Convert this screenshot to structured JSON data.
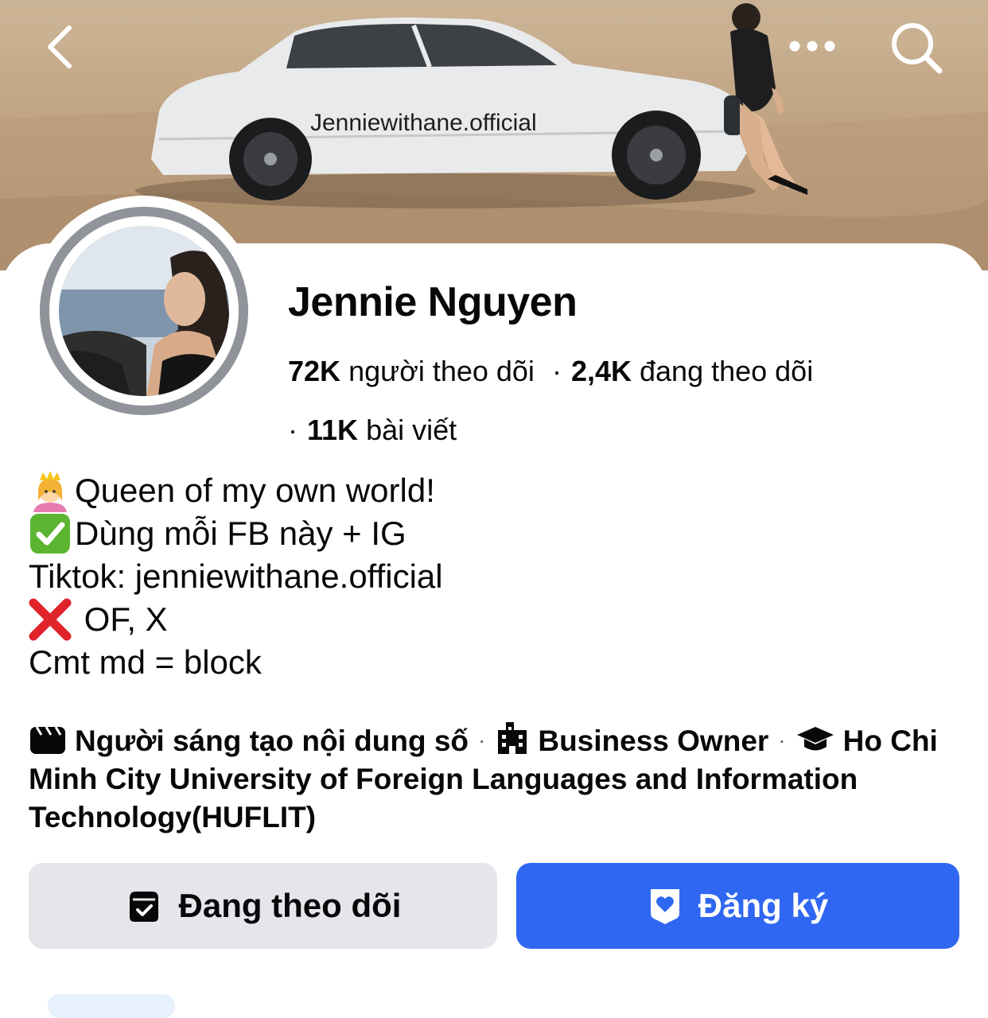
{
  "header": {
    "back_icon": "chevron-left-icon",
    "more_icon": "more-horizontal-icon",
    "search_icon": "search-icon"
  },
  "cover": {
    "car_text": "Jenniewithane.official"
  },
  "profile": {
    "name": "Jennie Nguyen",
    "followers_count": "72K",
    "followers_label": "người theo dõi",
    "following_count": "2,4K",
    "following_label": "đang theo dõi",
    "posts_count": "11K",
    "posts_label": "bài viết"
  },
  "bio": {
    "line1": "Queen of my own world!",
    "line2": "Dùng mỗi FB này + IG",
    "line3": "Tiktok: jenniewithane.official",
    "line4": " OF, X",
    "line5": "Cmt md = block"
  },
  "details": {
    "category": "Người sáng tạo nội dung số",
    "work": "Business Owner",
    "education": "Ho Chi Minh City University of Foreign Languages and Information Technology(HUFLIT)"
  },
  "actions": {
    "following_label": "Đang theo dõi",
    "subscribe_label": "Đăng ký"
  },
  "colors": {
    "primary_blue": "#3067f2",
    "secondary_gray": "#e4e6eb",
    "avatar_ring": "#909399"
  }
}
